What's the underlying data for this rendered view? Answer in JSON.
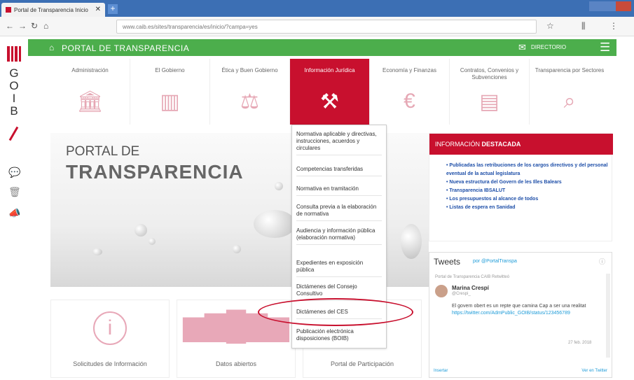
{
  "browser": {
    "tab_title": "Portal de Transparencia Inicio",
    "tab_close": "✕",
    "new_tab": "+",
    "url": "www.caib.es/sites/transparencia/es/inicio/?campa=yes"
  },
  "sidebar": {
    "logo_text": [
      "G",
      "O",
      "I",
      "B"
    ]
  },
  "header": {
    "home_glyph": "⌂",
    "title": "PORTAL DE TRANSPARENCIA",
    "directory": "DIRECTORIO",
    "menu_glyph": "☰"
  },
  "tiles": [
    {
      "label": "Administración",
      "icon": "bank-icon",
      "glyph": "🏛"
    },
    {
      "label": "El Gobierno",
      "icon": "building-icon",
      "glyph": "▥"
    },
    {
      "label": "Ética y Buen Gobierno",
      "icon": "scales-icon",
      "glyph": "⚖"
    },
    {
      "label": "Información Jurídica",
      "icon": "gavel-icon",
      "glyph": "⚒"
    },
    {
      "label": "Economía y Finanzas",
      "icon": "euro-icon",
      "glyph": "€"
    },
    {
      "label": "Contratos, Convenios y Subvenciones",
      "icon": "document-icon",
      "glyph": "▤"
    },
    {
      "label": "Transparencia por Sectores",
      "icon": "magnifier-chart-icon",
      "glyph": "⌕"
    }
  ],
  "hero": {
    "line1": "PORTAL DE",
    "line2": "TRANSPARENCIA"
  },
  "dropdown": [
    "Normativa aplicable y directivas, instrucciones, acuerdos y circulares",
    "Competencias transferidas",
    "Normativa en tramitación",
    "Consulta previa a la elaboración de normativa",
    "Audiencia y información pública (elaboración normativa)",
    "Expedientes en exposición pública",
    "Dictámenes del Consejo Consultivo",
    "Dictámenes del CES",
    "Publicación electrónica disposiciones (BOIB)"
  ],
  "info": {
    "header_prefix": "INFORMACIÓN",
    "header_bold": "DESTACADA",
    "items": [
      "Publicadas las retribuciones de los cargos directivos y del personal eventual de la actual legislatura",
      "Nueva estructura del Govern de les Illes Balears",
      "Transparencia IBSALUT",
      "Los presupuestos al alcance de todos",
      "Listas de espera en Sanidad"
    ]
  },
  "tweets": {
    "title": "Tweets",
    "by": "por @PortalTranspa",
    "retweet": "Portal de Transparencia CAIB Retwitteó",
    "name": "Marina Crespí",
    "handle": "@Crespi_",
    "text": "El govern obert es un repte que camina Cap a ser una realitat",
    "link": "https://twitter.com/AdmPublic_GOIB/status/123456789",
    "date": "27 feb. 2018",
    "embed": "Insertar",
    "view": "Ver en Twitter"
  },
  "cards": [
    {
      "label": "Solicitudes de Información",
      "icon": "info-circle-icon"
    },
    {
      "label": "Datos abiertos",
      "icon": "bar-chart-icon"
    },
    {
      "label": "Portal de Participación",
      "icon": "participation-icon"
    }
  ]
}
